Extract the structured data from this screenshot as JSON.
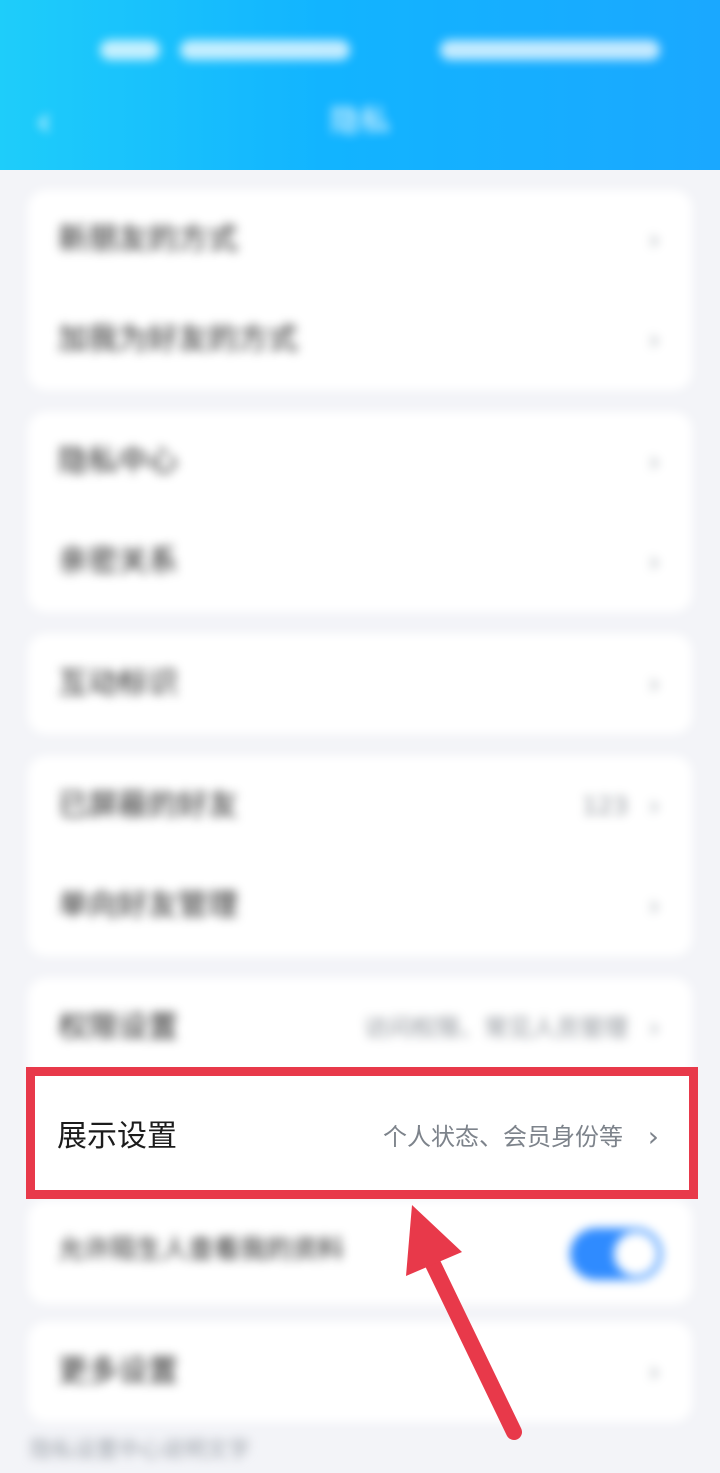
{
  "header": {
    "title": "隐私",
    "back_icon": "‹",
    "gradient_start": "#1ecdfa",
    "gradient_end": "#1aa8ff"
  },
  "groups": [
    {
      "items": [
        {
          "label": "新朋友的方式"
        },
        {
          "label": "加我为好友的方式"
        }
      ]
    },
    {
      "items": [
        {
          "label": "隐私中心"
        },
        {
          "label": "亲密关系"
        }
      ]
    },
    {
      "items": [
        {
          "label": "互动标识"
        }
      ]
    },
    {
      "items": [
        {
          "label": "已屏蔽的好友",
          "value": "123"
        },
        {
          "label": "单向好友管理"
        }
      ]
    },
    {
      "items": [
        {
          "label": "权限设置",
          "value": "访问权限、常见人员管理"
        }
      ]
    }
  ],
  "highlighted_item": {
    "label": "展示设置",
    "value": "个人状态、会员身份等",
    "chevron": "›"
  },
  "toggle_item": {
    "label": "允许陌生人查看我的资料",
    "enabled": true
  },
  "last_item": {
    "label": "更多设置"
  },
  "footer_note": "隐私设置中心说明文字",
  "accent_color": "#e8394a",
  "toggle_color": "#2f8bff"
}
